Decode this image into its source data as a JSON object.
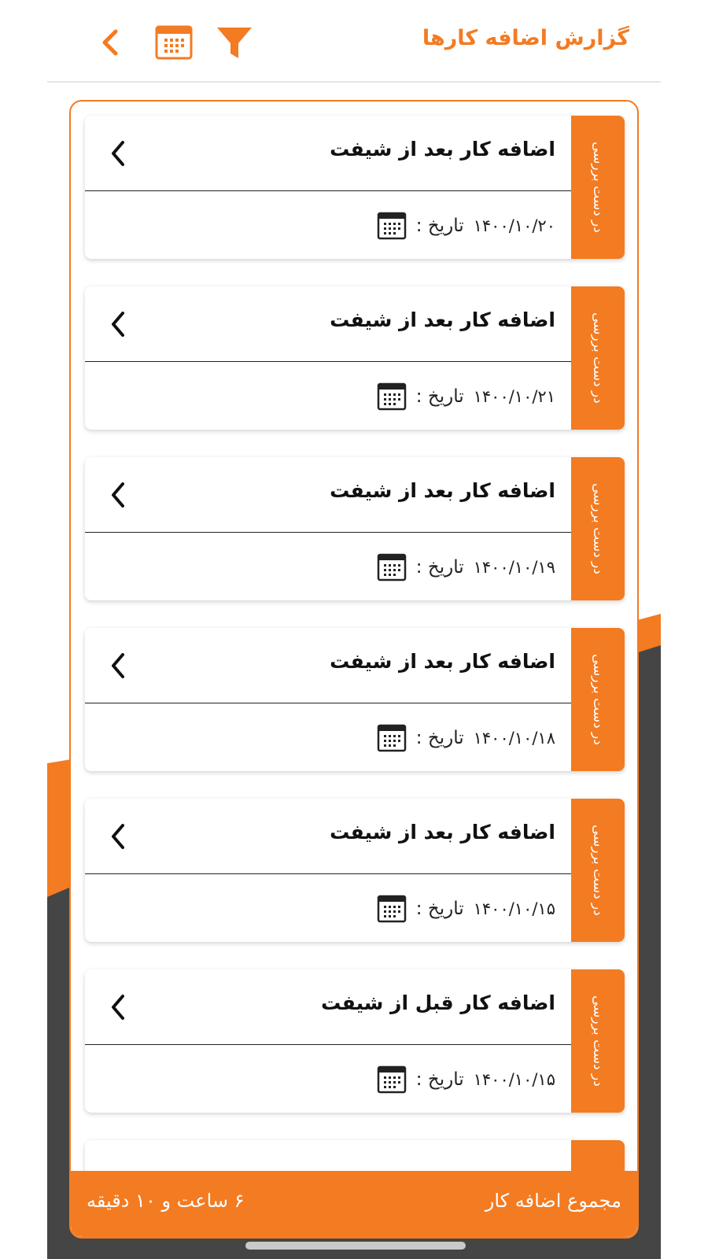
{
  "colors": {
    "accent": "#f37b22",
    "dark_bg": "#454545",
    "text": "#111111"
  },
  "header": {
    "title": "گزارش اضافه کارها",
    "back_icon": "chevron-left-icon",
    "calendar_icon": "calendar-icon",
    "filter_icon": "filter-icon"
  },
  "list": {
    "items": [
      {
        "title": "اضافه کار بعد از شیفت",
        "status": "در دست بررسی",
        "date_label": "تاریخ :",
        "date": "۱۴۰۰/۱۰/۲۰"
      },
      {
        "title": "اضافه کار بعد از شیفت",
        "status": "در دست بررسی",
        "date_label": "تاریخ :",
        "date": "۱۴۰۰/۱۰/۲۱"
      },
      {
        "title": "اضافه کار بعد از شیفت",
        "status": "در دست بررسی",
        "date_label": "تاریخ :",
        "date": "۱۴۰۰/۱۰/۱۹"
      },
      {
        "title": "اضافه کار بعد از شیفت",
        "status": "در دست بررسی",
        "date_label": "تاریخ :",
        "date": "۱۴۰۰/۱۰/۱۸"
      },
      {
        "title": "اضافه کار بعد از شیفت",
        "status": "در دست بررسی",
        "date_label": "تاریخ :",
        "date": "۱۴۰۰/۱۰/۱۵"
      },
      {
        "title": "اضافه کار قبل از شیفت",
        "status": "در دست بررسی",
        "date_label": "تاریخ :",
        "date": "۱۴۰۰/۱۰/۱۵"
      }
    ]
  },
  "footer": {
    "label": "مجموع اضافه کار",
    "value": "۶ ساعت و ۱۰ دقیقه"
  }
}
